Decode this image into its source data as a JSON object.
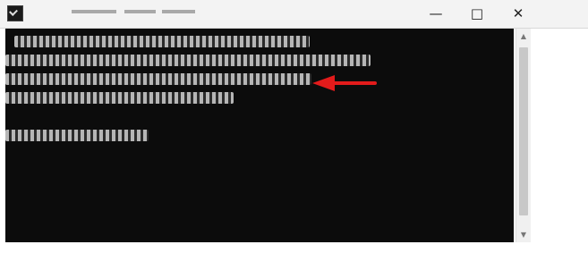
{
  "window": {
    "controls": {
      "minimize": "—",
      "maximize": "□",
      "close": "✕"
    },
    "app_icon": "terminal-icon"
  },
  "terminal": {
    "background": "#0c0c0c",
    "foreground": "#cccccc"
  },
  "annotation": {
    "icon": "red-arrow-icon",
    "color": "#e31b1b"
  },
  "scrollbar": {
    "up_icon": "scroll-up-arrow-icon",
    "down_icon": "scroll-down-arrow-icon"
  }
}
